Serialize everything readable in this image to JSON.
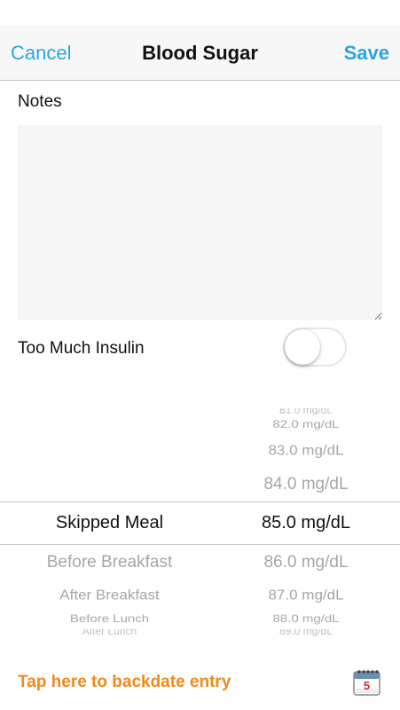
{
  "navbar": {
    "cancel_label": "Cancel",
    "title": "Blood Sugar",
    "save_label": "Save"
  },
  "notes": {
    "label": "Notes",
    "value": ""
  },
  "too_much_insulin": {
    "label": "Too Much Insulin",
    "on": false
  },
  "picker": {
    "meal_column": {
      "options": [
        "Before Breakfast",
        "After Breakfast",
        "Before Lunch",
        "After Lunch"
      ],
      "selected": "Skipped Meal"
    },
    "glucose_column": {
      "values_above": [
        "81.0 mg/dL",
        "82.0 mg/dL",
        "83.0 mg/dL",
        "84.0 mg/dL"
      ],
      "selected": "85.0 mg/dL",
      "values_below": [
        "86.0 mg/dL",
        "87.0 mg/dL",
        "88.0 mg/dL",
        "89.0 mg/dL"
      ]
    }
  },
  "footer": {
    "backdate_label": "Tap here to backdate entry",
    "calendar_day": "5"
  },
  "colors": {
    "accent_blue": "#2aa6e0",
    "backdate_orange": "#f08a1c",
    "calendar_red": "#d12b1f"
  }
}
